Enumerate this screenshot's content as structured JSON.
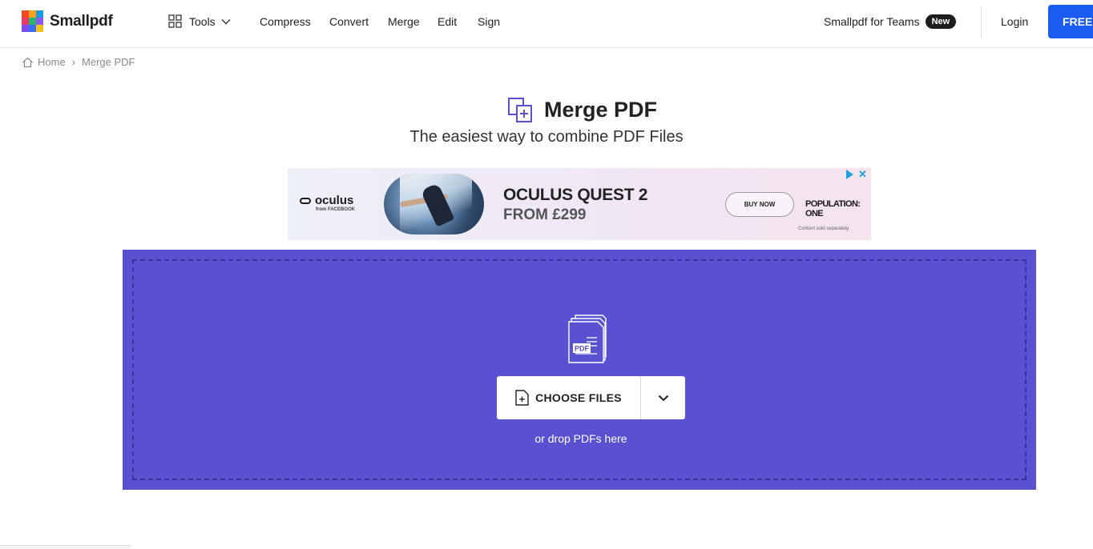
{
  "header": {
    "logo_text": "Smallpdf",
    "logo_colors": [
      "#f04b23",
      "#f9a21b",
      "#1a9be0",
      "#e63a6d",
      "#2fb46e",
      "#8c58f4",
      "#7b4df0",
      "#3b6bf3",
      "#f2c11c"
    ],
    "tools_label": "Tools",
    "nav": [
      "Compress",
      "Convert",
      "Merge",
      "Edit",
      "Sign"
    ],
    "teams_label": "Smallpdf for Teams",
    "teams_badge": "New",
    "login_label": "Login",
    "cta_label": "FREE TRIAL"
  },
  "breadcrumb": {
    "home": "Home",
    "separator": "›",
    "current": "Merge PDF"
  },
  "page": {
    "title": "Merge PDF",
    "subtitle": "The easiest way to combine PDF Files",
    "accent_color": "#5a50d2"
  },
  "ad": {
    "brand": "oculus",
    "brand_sub": "from FACEBOOK",
    "headline": "OCULUS QUEST 2",
    "price": "FROM £299",
    "cta": "BUY NOW",
    "partner": "POPULATION: ONE",
    "fine_print": "Content sold separately."
  },
  "dropzone": {
    "icon_label": "PDF",
    "choose_label": "CHOOSE FILES",
    "hint": "or drop PDFs here"
  }
}
